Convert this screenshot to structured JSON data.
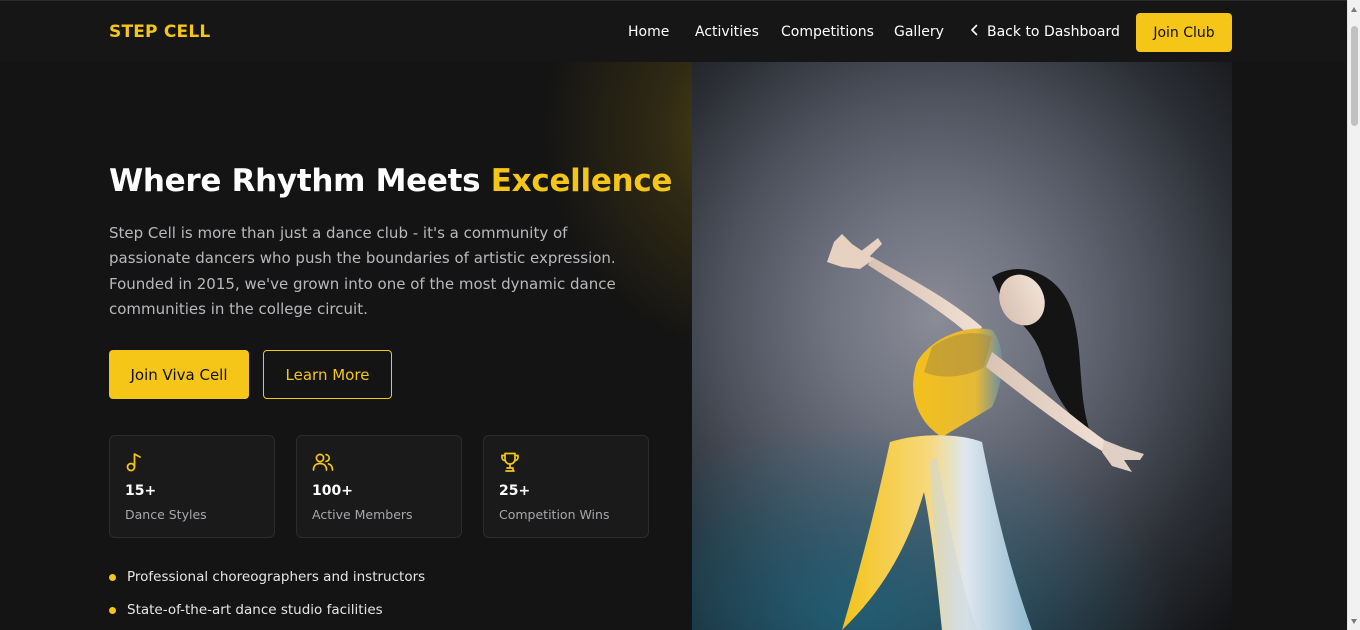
{
  "nav": {
    "logo": "STEP CELL",
    "links": [
      "Home",
      "Activities",
      "Competitions",
      "Gallery"
    ],
    "back_label": "Back to Dashboard",
    "join_label": "Join Club"
  },
  "hero": {
    "title_main": "Where Rhythm Meets ",
    "title_accent": "Excellence",
    "description": "Step Cell is more than just a dance club - it's a community of passionate dancers who push the boundaries of artistic expression. Founded in 2015, we've grown into one of the most dynamic dance communities in the college circuit.",
    "primary_button": "Join Viva Cell",
    "secondary_button": "Learn More",
    "stats": [
      {
        "icon": "music-note-icon",
        "value": "15+",
        "label": "Dance Styles"
      },
      {
        "icon": "users-icon",
        "value": "100+",
        "label": "Active Members"
      },
      {
        "icon": "trophy-icon",
        "value": "25+",
        "label": "Competition Wins"
      }
    ],
    "features": [
      "Professional choreographers and instructors",
      "State-of-the-art dance studio facilities"
    ]
  },
  "colors": {
    "accent": "#f5c518",
    "background": "#141414",
    "navbar": "#161616",
    "card": "#1a1a1a",
    "muted_text": "#b9b9bd"
  }
}
